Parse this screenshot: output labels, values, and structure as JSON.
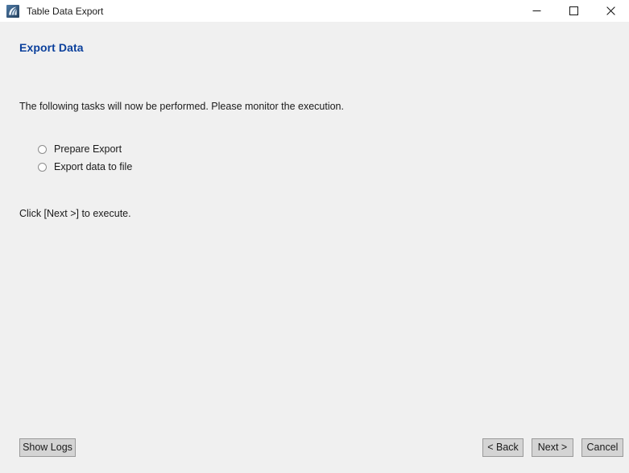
{
  "window": {
    "title": "Table Data Export",
    "icon": "app-icon",
    "controls": [
      {
        "name": "minimize-button",
        "icon": "minimize-icon",
        "label": "Minimize"
      },
      {
        "name": "maximize-button",
        "icon": "maximize-icon",
        "label": "Maximize"
      },
      {
        "name": "close-button",
        "icon": "close-icon",
        "label": "Close"
      }
    ]
  },
  "page": {
    "heading": "Export Data",
    "heading_color": "#0b409c",
    "intro": "The following tasks will now be performed. Please monitor the execution.",
    "hint": "Click [Next >] to execute."
  },
  "tasks": [
    {
      "label": "Prepare Export",
      "status": "pending"
    },
    {
      "label": "Export data to file",
      "status": "pending"
    }
  ],
  "footer": {
    "show_logs_label": "Show Logs",
    "back_label": "< Back",
    "next_label": "Next >",
    "cancel_label": "Cancel"
  }
}
